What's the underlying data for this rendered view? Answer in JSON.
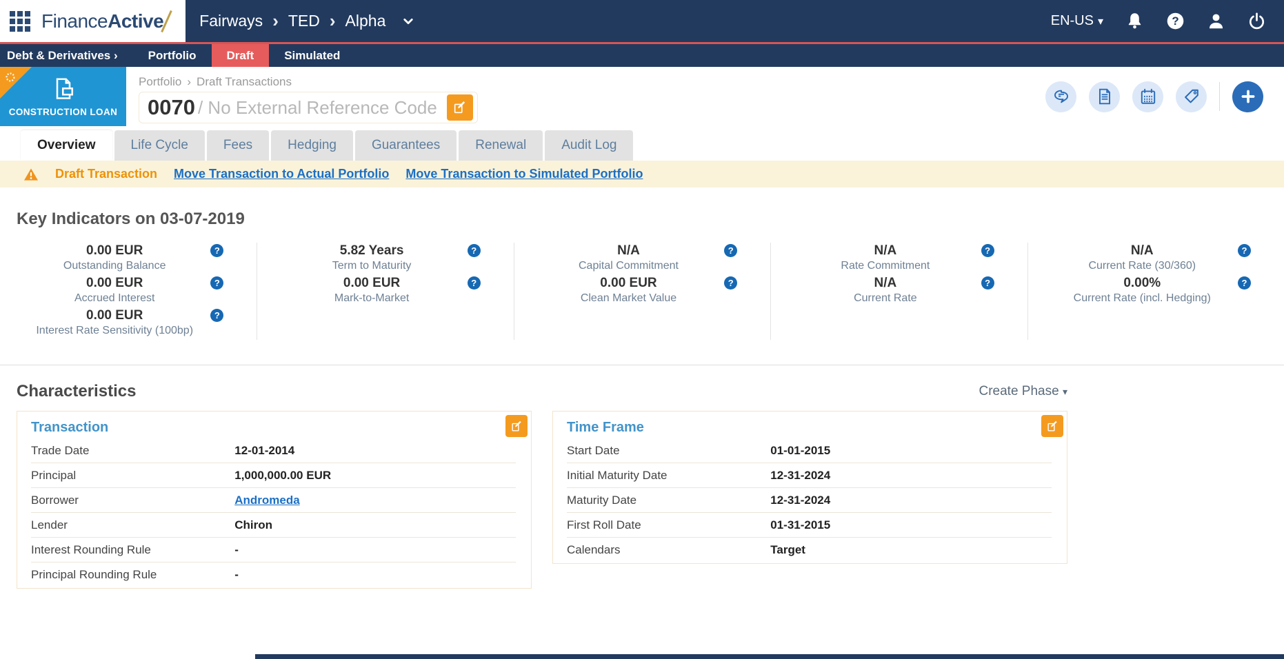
{
  "topbar": {
    "logo_part1": "Finance",
    "logo_part2": "Active",
    "breadcrumb": [
      "Fairways",
      "TED",
      "Alpha"
    ],
    "language": "EN-US"
  },
  "navbar": {
    "items": [
      {
        "label": "Debt & Derivatives ›"
      },
      {
        "label": "Portfolio"
      },
      {
        "label": "Draft",
        "active": true
      },
      {
        "label": "Simulated"
      }
    ]
  },
  "header": {
    "type_badge": "CONSTRUCTION LOAN",
    "breadcrumb": [
      "Portfolio",
      "Draft Transactions"
    ],
    "id": "0070",
    "title_suffix": "/ No External Reference Code"
  },
  "tabs": [
    "Overview",
    "Life Cycle",
    "Fees",
    "Hedging",
    "Guarantees",
    "Renewal",
    "Audit Log"
  ],
  "banner": {
    "status": "Draft Transaction",
    "link_actual": "Move Transaction to Actual Portfolio",
    "link_simulated": "Move Transaction to Simulated Portfolio"
  },
  "key_indicators": {
    "title": "Key Indicators on 03-07-2019",
    "columns": [
      {
        "items": [
          {
            "value": "0.00 EUR",
            "label": "Outstanding Balance"
          },
          {
            "value": "0.00 EUR",
            "label": "Accrued Interest"
          },
          {
            "value": "0.00 EUR",
            "label": "Interest Rate Sensitivity (100bp)"
          }
        ]
      },
      {
        "items": [
          {
            "value": "5.82 Years",
            "label": "Term to Maturity"
          },
          {
            "value": "0.00 EUR",
            "label": "Mark-to-Market"
          }
        ]
      },
      {
        "items": [
          {
            "value": "N/A",
            "label": "Capital Commitment"
          },
          {
            "value": "0.00 EUR",
            "label": "Clean Market Value"
          }
        ]
      },
      {
        "items": [
          {
            "value": "N/A",
            "label": "Rate Commitment"
          },
          {
            "value": "N/A",
            "label": "Current Rate"
          }
        ]
      },
      {
        "items": [
          {
            "value": "N/A",
            "label": "Current Rate (30/360)"
          },
          {
            "value": "0.00%",
            "label": "Current Rate (incl. Hedging)"
          }
        ]
      }
    ]
  },
  "characteristics": {
    "title": "Characteristics",
    "create_phase": "Create Phase",
    "transaction": {
      "title": "Transaction",
      "rows": [
        {
          "label": "Trade Date",
          "value": "12-01-2014"
        },
        {
          "label": "Principal",
          "value": "1,000,000.00 EUR"
        },
        {
          "label": "Borrower",
          "value": "Andromeda"
        },
        {
          "label": "Lender",
          "value": "Chiron"
        },
        {
          "label": "Interest Rounding Rule",
          "value": "-"
        },
        {
          "label": "Principal Rounding Rule",
          "value": "-"
        }
      ]
    },
    "time_frame": {
      "title": "Time Frame",
      "rows": [
        {
          "label": "Start Date",
          "value": "01-01-2015"
        },
        {
          "label": "Initial Maturity Date",
          "value": "12-31-2024"
        },
        {
          "label": "Maturity Date",
          "value": "12-31-2024"
        },
        {
          "label": "First Roll Date",
          "value": "01-31-2015"
        },
        {
          "label": "Calendars",
          "value": "Target"
        }
      ]
    }
  },
  "colors": {
    "navy": "#223a5e",
    "red_accent": "#e65c5c",
    "badge_blue": "#2095d3",
    "orange": "#f49b1f",
    "banner_bg": "#faf3da",
    "link_blue": "#1b6fc5",
    "icon_blue": "#2b6cb8",
    "help_blue": "#1668b3"
  }
}
